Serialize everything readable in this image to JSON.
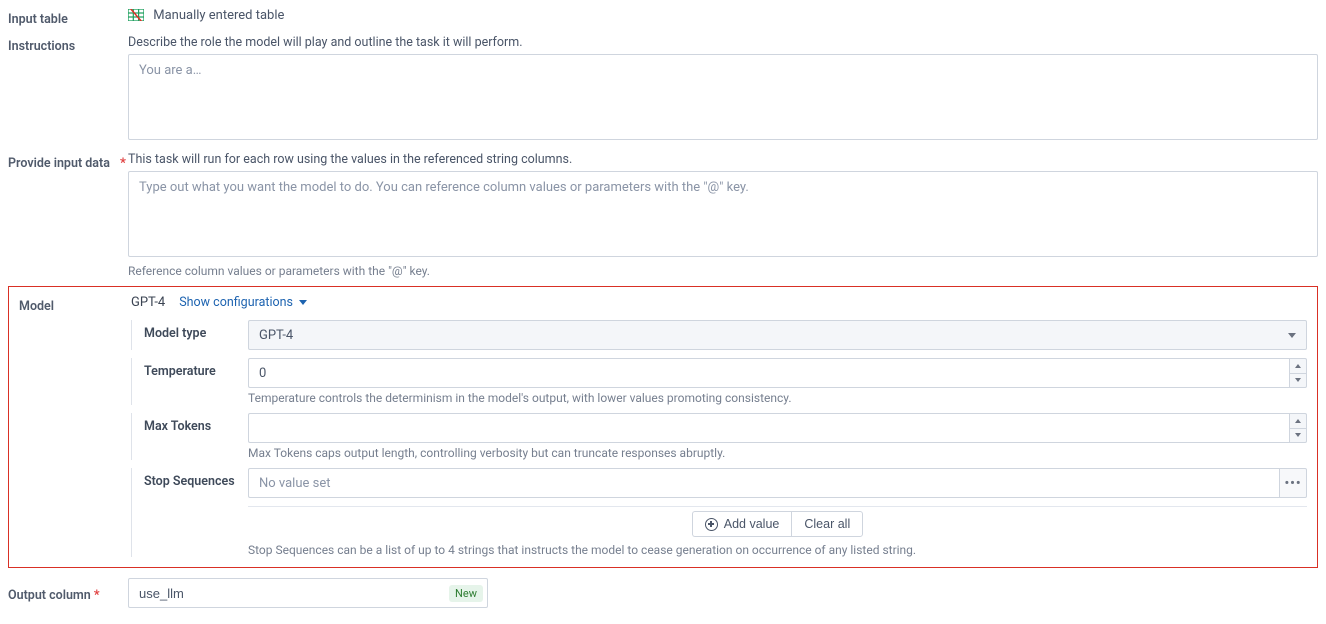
{
  "input_table": {
    "label": "Input table",
    "value": "Manually entered table"
  },
  "instructions": {
    "label": "Instructions",
    "description": "Describe the role the model will play and outline the task it will perform.",
    "placeholder": "You are a…"
  },
  "input_data": {
    "label": "Provide input data",
    "description": "This task will run for each row using the values in the referenced string columns.",
    "placeholder": "Type out what you want the model to do. You can reference column values or parameters with the \"@\" key.",
    "helper": "Reference column values or parameters with the \"@\" key."
  },
  "model": {
    "label": "Model",
    "name": "GPT-4",
    "show_config_link": "Show configurations",
    "fields": {
      "type": {
        "label": "Model type",
        "value": "GPT-4"
      },
      "temperature": {
        "label": "Temperature",
        "value": "0",
        "helper": "Temperature controls the determinism in the model's output, with lower values promoting consistency."
      },
      "max_tokens": {
        "label": "Max Tokens",
        "value": "",
        "helper": "Max Tokens caps output length, controlling verbosity but can truncate responses abruptly."
      },
      "stop_seq": {
        "label": "Stop Sequences",
        "value": "No value set",
        "helper": "Stop Sequences can be a list of up to 4 strings that instructs the model to cease generation on occurrence of any listed string."
      }
    },
    "actions": {
      "add_value": "Add value",
      "clear_all": "Clear all"
    }
  },
  "output_column": {
    "label": "Output column",
    "value": "use_llm",
    "badge": "New"
  }
}
